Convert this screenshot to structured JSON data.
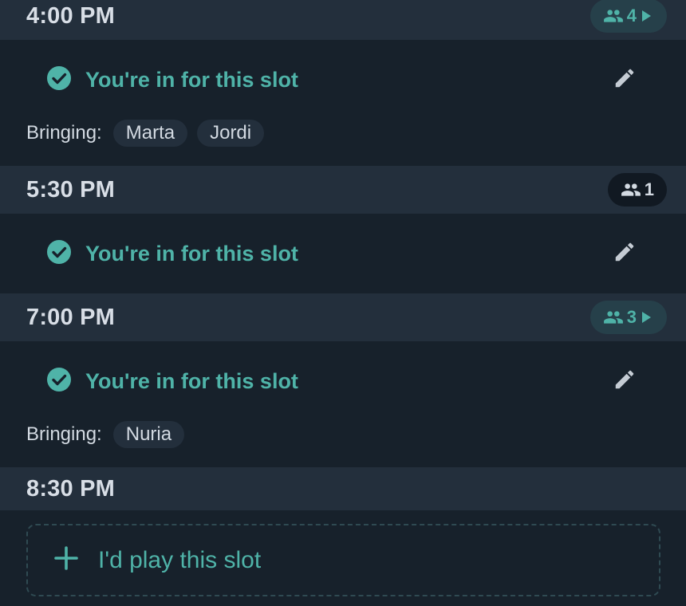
{
  "colors": {
    "accent": "#4fb3a8",
    "background": "#17212b",
    "header": "#232f3c"
  },
  "slots": [
    {
      "time": "4:00 PM",
      "count": "4",
      "count_icon": "group-icon",
      "expand_icon": "play-arrow-icon",
      "status": "You're in for this slot",
      "bringing_label": "Bringing:",
      "bringing": [
        "Marta",
        "Jordi"
      ]
    },
    {
      "time": "5:30 PM",
      "count": "1",
      "count_icon": "group-icon",
      "status": "You're in for this slot"
    },
    {
      "time": "7:00 PM",
      "count": "3",
      "count_icon": "group-icon",
      "expand_icon": "play-arrow-icon",
      "status": "You're in for this slot",
      "bringing_label": "Bringing:",
      "bringing": [
        "Nuria"
      ]
    },
    {
      "time": "8:30 PM",
      "join_label": "I'd play this slot",
      "join_icon": "plus-icon"
    }
  ]
}
